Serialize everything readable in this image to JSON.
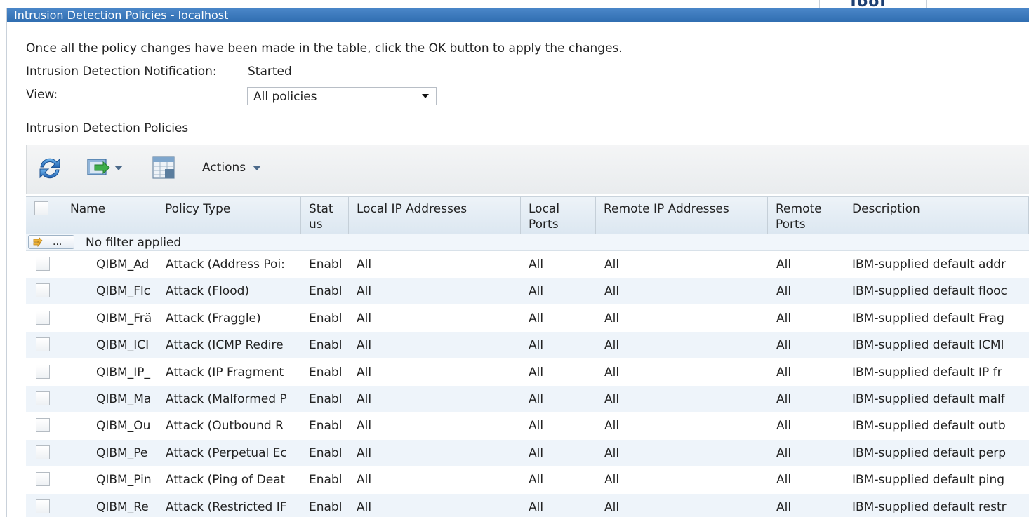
{
  "window": {
    "title": "Intrusion Detection Policies - localhost",
    "background_tab_label": "Tool"
  },
  "intro": {
    "instruction": "Once all the policy changes have been made in the table, click the OK button to apply the changes.",
    "notification_label": "Intrusion Detection Notification:",
    "notification_value": "Started",
    "view_label": "View:",
    "view_value": "All policies",
    "section_heading": "Intrusion Detection Policies"
  },
  "toolbar": {
    "refresh_icon": "refresh-icon",
    "export_icon": "export-icon",
    "columns_icon": "table-config-icon",
    "actions_label": "Actions"
  },
  "columns": [
    {
      "label": ""
    },
    {
      "label": "Name"
    },
    {
      "label": "Policy Type"
    },
    {
      "label": "Stat\nus"
    },
    {
      "label": "Local IP Addresses"
    },
    {
      "label": "Local\nPorts"
    },
    {
      "label": "Remote IP Addresses"
    },
    {
      "label": "Remote\nPorts"
    },
    {
      "label": "Description"
    }
  ],
  "filter": {
    "button_label": "⇶ ...",
    "status_text": "No filter applied"
  },
  "rows": [
    {
      "name": "QIBM_Ad",
      "type": "Attack (Address Poi:",
      "status": "Enabl",
      "local_ip": "All",
      "local_ports": "All",
      "remote_ip": "All",
      "remote_ports": "All",
      "description": "IBM-supplied default addr"
    },
    {
      "name": "QIBM_Flc",
      "type": "Attack (Flood)",
      "status": "Enabl",
      "local_ip": "All",
      "local_ports": "All",
      "remote_ip": "All",
      "remote_ports": "All",
      "description": "IBM-supplied default flooc"
    },
    {
      "name": "QIBM_Frä",
      "type": "Attack (Fraggle)",
      "status": "Enabl",
      "local_ip": "All",
      "local_ports": "All",
      "remote_ip": "All",
      "remote_ports": "All",
      "description": "IBM-supplied default Frag"
    },
    {
      "name": "QIBM_ICI",
      "type": "Attack (ICMP Redire",
      "status": "Enabl",
      "local_ip": "All",
      "local_ports": "All",
      "remote_ip": "All",
      "remote_ports": "All",
      "description": "IBM-supplied default ICMI"
    },
    {
      "name": "QIBM_IP_",
      "type": "Attack (IP Fragment",
      "status": "Enabl",
      "local_ip": "All",
      "local_ports": "All",
      "remote_ip": "All",
      "remote_ports": "All",
      "description": "IBM-supplied default IP fr"
    },
    {
      "name": "QIBM_Ma",
      "type": "Attack (Malformed P",
      "status": "Enabl",
      "local_ip": "All",
      "local_ports": "All",
      "remote_ip": "All",
      "remote_ports": "All",
      "description": "IBM-supplied default malf"
    },
    {
      "name": "QIBM_Ou",
      "type": "Attack (Outbound R",
      "status": "Enabl",
      "local_ip": "All",
      "local_ports": "All",
      "remote_ip": "All",
      "remote_ports": "All",
      "description": "IBM-supplied default outb"
    },
    {
      "name": "QIBM_Pe",
      "type": "Attack (Perpetual Ec",
      "status": "Enabl",
      "local_ip": "All",
      "local_ports": "All",
      "remote_ip": "All",
      "remote_ports": "All",
      "description": "IBM-supplied default perp"
    },
    {
      "name": "QIBM_Pin",
      "type": "Attack (Ping of Deat",
      "status": "Enabl",
      "local_ip": "All",
      "local_ports": "All",
      "remote_ip": "All",
      "remote_ports": "All",
      "description": "IBM-supplied default ping"
    },
    {
      "name": "QIBM_Re",
      "type": "Attack (Restricted IF",
      "status": "Enabl",
      "local_ip": "All",
      "local_ports": "All",
      "remote_ip": "All",
      "remote_ports": "All",
      "description": "IBM-supplied default restr"
    }
  ],
  "colors": {
    "titlebar": "#2f6db0",
    "header_bg": "#dce7f1",
    "alt_row": "#eef4fa"
  }
}
